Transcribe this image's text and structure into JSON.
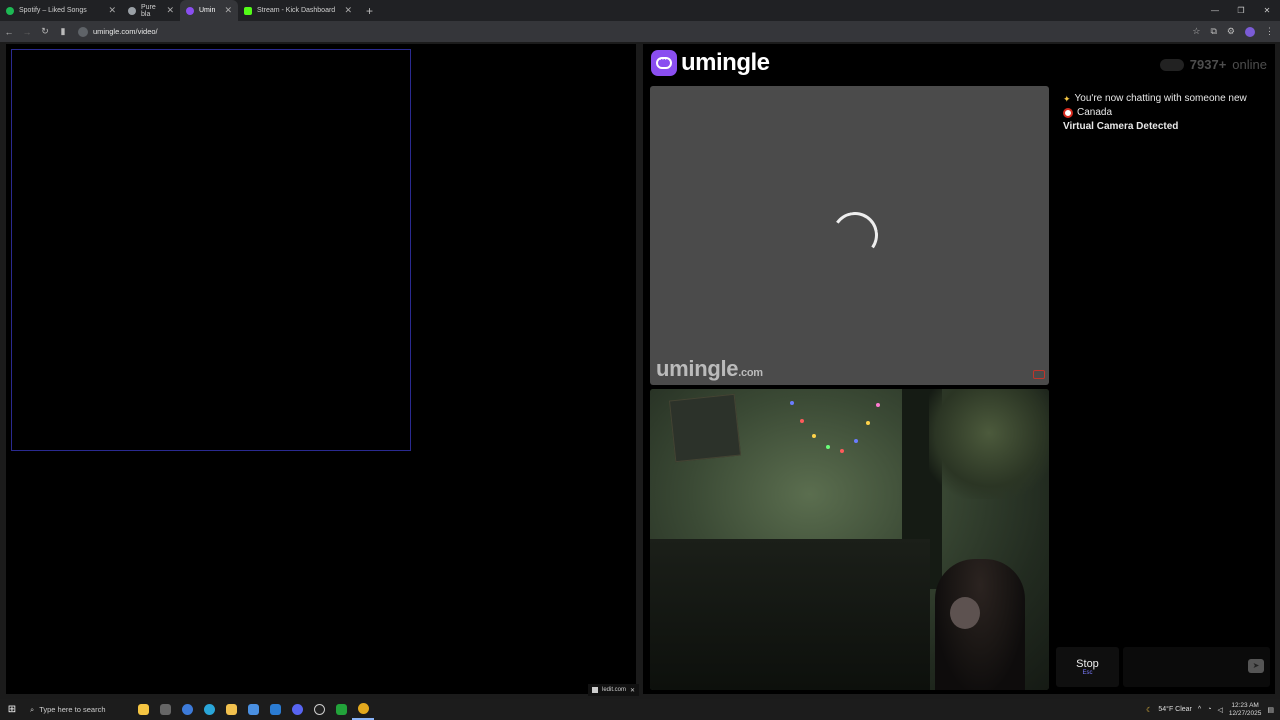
{
  "browser": {
    "tabs": [
      {
        "label": "Spotify – Liked Songs",
        "color": "#1db954",
        "active": false
      },
      {
        "label": "Pure bla",
        "color": "#9aa0a6",
        "active": false
      },
      {
        "label": "Umin",
        "color": "#8a4ef0",
        "active": true
      },
      {
        "label": "Stream - Kick Dashboard",
        "color": "#53fc18",
        "active": false
      }
    ],
    "new_tab": "+",
    "url": "umingle.com/video/"
  },
  "left_pane": {
    "share_chip": "ledit.com"
  },
  "site": {
    "logo_text": "umingle",
    "online_count": "7937+",
    "online_label": "online",
    "watermark_main": "umingle",
    "watermark_suffix": ".com"
  },
  "chat": {
    "messages": [
      {
        "icon": "sparkle-icon",
        "text": "You're now chatting with someone new"
      },
      {
        "icon": "canada-flag-icon",
        "text": "Canada"
      },
      {
        "icon": "",
        "text": "Virtual Camera Detected"
      }
    ]
  },
  "controls": {
    "stop_label": "Stop",
    "stop_key": "Esc"
  },
  "taskbar": {
    "search_placeholder": "Type here to search",
    "weather": "54°F  Clear",
    "time": "12:23 AM",
    "date": "12/27/2025"
  }
}
